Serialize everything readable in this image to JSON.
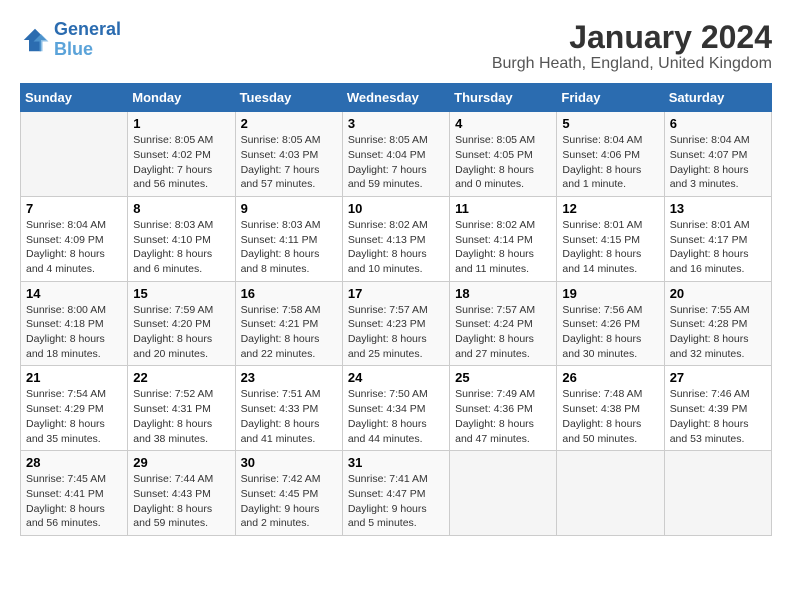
{
  "logo": {
    "line1": "General",
    "line2": "Blue"
  },
  "title": "January 2024",
  "location": "Burgh Heath, England, United Kingdom",
  "days_header": [
    "Sunday",
    "Monday",
    "Tuesday",
    "Wednesday",
    "Thursday",
    "Friday",
    "Saturday"
  ],
  "weeks": [
    [
      {
        "day": "",
        "sunrise": "",
        "sunset": "",
        "daylight": ""
      },
      {
        "day": "1",
        "sunrise": "Sunrise: 8:05 AM",
        "sunset": "Sunset: 4:02 PM",
        "daylight": "Daylight: 7 hours and 56 minutes."
      },
      {
        "day": "2",
        "sunrise": "Sunrise: 8:05 AM",
        "sunset": "Sunset: 4:03 PM",
        "daylight": "Daylight: 7 hours and 57 minutes."
      },
      {
        "day": "3",
        "sunrise": "Sunrise: 8:05 AM",
        "sunset": "Sunset: 4:04 PM",
        "daylight": "Daylight: 7 hours and 59 minutes."
      },
      {
        "day": "4",
        "sunrise": "Sunrise: 8:05 AM",
        "sunset": "Sunset: 4:05 PM",
        "daylight": "Daylight: 8 hours and 0 minutes."
      },
      {
        "day": "5",
        "sunrise": "Sunrise: 8:04 AM",
        "sunset": "Sunset: 4:06 PM",
        "daylight": "Daylight: 8 hours and 1 minute."
      },
      {
        "day": "6",
        "sunrise": "Sunrise: 8:04 AM",
        "sunset": "Sunset: 4:07 PM",
        "daylight": "Daylight: 8 hours and 3 minutes."
      }
    ],
    [
      {
        "day": "7",
        "sunrise": "Sunrise: 8:04 AM",
        "sunset": "Sunset: 4:09 PM",
        "daylight": "Daylight: 8 hours and 4 minutes."
      },
      {
        "day": "8",
        "sunrise": "Sunrise: 8:03 AM",
        "sunset": "Sunset: 4:10 PM",
        "daylight": "Daylight: 8 hours and 6 minutes."
      },
      {
        "day": "9",
        "sunrise": "Sunrise: 8:03 AM",
        "sunset": "Sunset: 4:11 PM",
        "daylight": "Daylight: 8 hours and 8 minutes."
      },
      {
        "day": "10",
        "sunrise": "Sunrise: 8:02 AM",
        "sunset": "Sunset: 4:13 PM",
        "daylight": "Daylight: 8 hours and 10 minutes."
      },
      {
        "day": "11",
        "sunrise": "Sunrise: 8:02 AM",
        "sunset": "Sunset: 4:14 PM",
        "daylight": "Daylight: 8 hours and 11 minutes."
      },
      {
        "day": "12",
        "sunrise": "Sunrise: 8:01 AM",
        "sunset": "Sunset: 4:15 PM",
        "daylight": "Daylight: 8 hours and 14 minutes."
      },
      {
        "day": "13",
        "sunrise": "Sunrise: 8:01 AM",
        "sunset": "Sunset: 4:17 PM",
        "daylight": "Daylight: 8 hours and 16 minutes."
      }
    ],
    [
      {
        "day": "14",
        "sunrise": "Sunrise: 8:00 AM",
        "sunset": "Sunset: 4:18 PM",
        "daylight": "Daylight: 8 hours and 18 minutes."
      },
      {
        "day": "15",
        "sunrise": "Sunrise: 7:59 AM",
        "sunset": "Sunset: 4:20 PM",
        "daylight": "Daylight: 8 hours and 20 minutes."
      },
      {
        "day": "16",
        "sunrise": "Sunrise: 7:58 AM",
        "sunset": "Sunset: 4:21 PM",
        "daylight": "Daylight: 8 hours and 22 minutes."
      },
      {
        "day": "17",
        "sunrise": "Sunrise: 7:57 AM",
        "sunset": "Sunset: 4:23 PM",
        "daylight": "Daylight: 8 hours and 25 minutes."
      },
      {
        "day": "18",
        "sunrise": "Sunrise: 7:57 AM",
        "sunset": "Sunset: 4:24 PM",
        "daylight": "Daylight: 8 hours and 27 minutes."
      },
      {
        "day": "19",
        "sunrise": "Sunrise: 7:56 AM",
        "sunset": "Sunset: 4:26 PM",
        "daylight": "Daylight: 8 hours and 30 minutes."
      },
      {
        "day": "20",
        "sunrise": "Sunrise: 7:55 AM",
        "sunset": "Sunset: 4:28 PM",
        "daylight": "Daylight: 8 hours and 32 minutes."
      }
    ],
    [
      {
        "day": "21",
        "sunrise": "Sunrise: 7:54 AM",
        "sunset": "Sunset: 4:29 PM",
        "daylight": "Daylight: 8 hours and 35 minutes."
      },
      {
        "day": "22",
        "sunrise": "Sunrise: 7:52 AM",
        "sunset": "Sunset: 4:31 PM",
        "daylight": "Daylight: 8 hours and 38 minutes."
      },
      {
        "day": "23",
        "sunrise": "Sunrise: 7:51 AM",
        "sunset": "Sunset: 4:33 PM",
        "daylight": "Daylight: 8 hours and 41 minutes."
      },
      {
        "day": "24",
        "sunrise": "Sunrise: 7:50 AM",
        "sunset": "Sunset: 4:34 PM",
        "daylight": "Daylight: 8 hours and 44 minutes."
      },
      {
        "day": "25",
        "sunrise": "Sunrise: 7:49 AM",
        "sunset": "Sunset: 4:36 PM",
        "daylight": "Daylight: 8 hours and 47 minutes."
      },
      {
        "day": "26",
        "sunrise": "Sunrise: 7:48 AM",
        "sunset": "Sunset: 4:38 PM",
        "daylight": "Daylight: 8 hours and 50 minutes."
      },
      {
        "day": "27",
        "sunrise": "Sunrise: 7:46 AM",
        "sunset": "Sunset: 4:39 PM",
        "daylight": "Daylight: 8 hours and 53 minutes."
      }
    ],
    [
      {
        "day": "28",
        "sunrise": "Sunrise: 7:45 AM",
        "sunset": "Sunset: 4:41 PM",
        "daylight": "Daylight: 8 hours and 56 minutes."
      },
      {
        "day": "29",
        "sunrise": "Sunrise: 7:44 AM",
        "sunset": "Sunset: 4:43 PM",
        "daylight": "Daylight: 8 hours and 59 minutes."
      },
      {
        "day": "30",
        "sunrise": "Sunrise: 7:42 AM",
        "sunset": "Sunset: 4:45 PM",
        "daylight": "Daylight: 9 hours and 2 minutes."
      },
      {
        "day": "31",
        "sunrise": "Sunrise: 7:41 AM",
        "sunset": "Sunset: 4:47 PM",
        "daylight": "Daylight: 9 hours and 5 minutes."
      },
      {
        "day": "",
        "sunrise": "",
        "sunset": "",
        "daylight": ""
      },
      {
        "day": "",
        "sunrise": "",
        "sunset": "",
        "daylight": ""
      },
      {
        "day": "",
        "sunrise": "",
        "sunset": "",
        "daylight": ""
      }
    ]
  ]
}
